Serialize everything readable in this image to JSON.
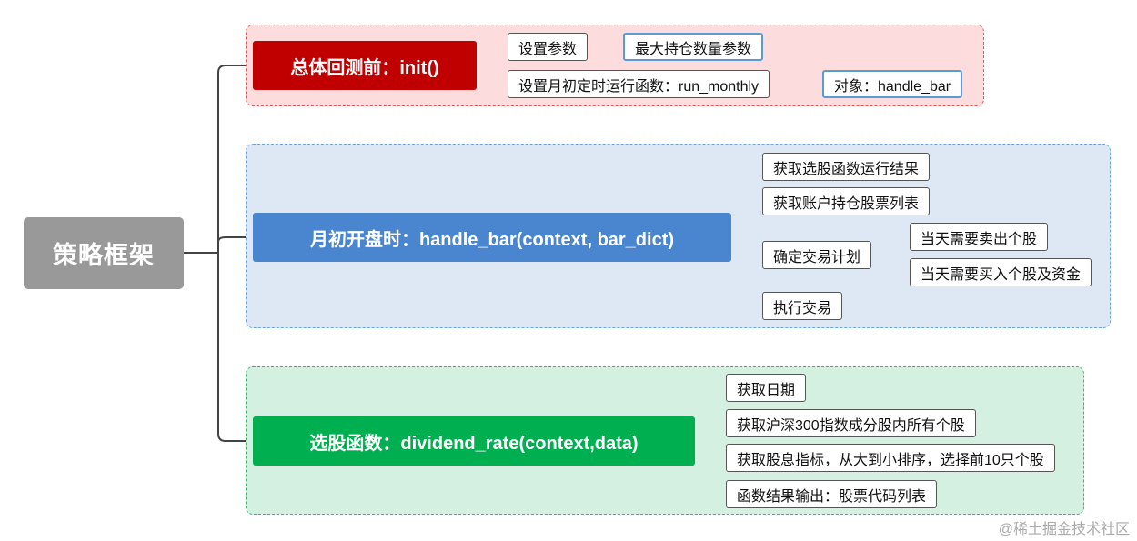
{
  "root": {
    "label": "策略框架"
  },
  "sections": [
    {
      "title": "总体回测前：init()",
      "color": "#c00000",
      "children": [
        {
          "label": "设置参数",
          "child": "最大持仓数量参数"
        },
        {
          "label": "设置月初定时运行函数：run_monthly",
          "child": "对象：handle_bar"
        }
      ]
    },
    {
      "title": "月初开盘时：handle_bar(context, bar_dict)",
      "color": "#4a86cf",
      "children": [
        {
          "label": "获取选股函数运行结果"
        },
        {
          "label": "获取账户持仓股票列表"
        },
        {
          "label": "确定交易计划",
          "subchildren": [
            "当天需要卖出个股",
            "当天需要买入个股及资金"
          ]
        },
        {
          "label": "执行交易"
        }
      ]
    },
    {
      "title": "选股函数：dividend_rate(context,data)",
      "color": "#00b050",
      "children": [
        {
          "label": "获取日期"
        },
        {
          "label": "获取沪深300指数成分股内所有个股"
        },
        {
          "label": "获取股息指标，从大到小排序，选择前10只个股"
        },
        {
          "label": "函数结果输出：股票代码列表"
        }
      ]
    }
  ],
  "watermark": "@稀土掘金技术社区"
}
